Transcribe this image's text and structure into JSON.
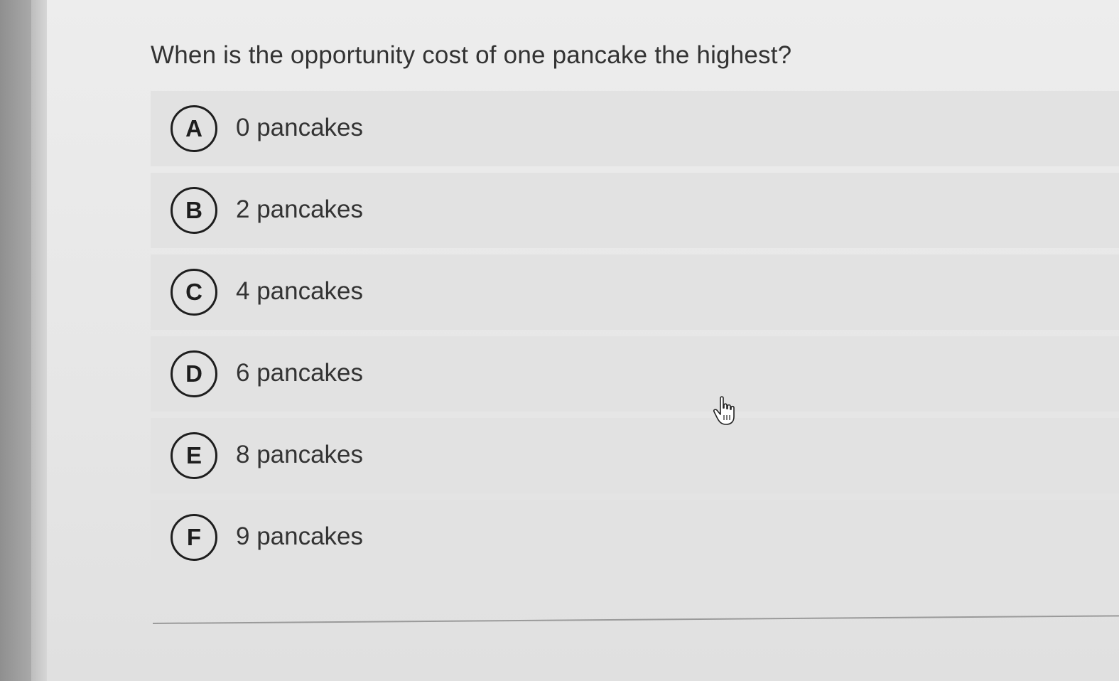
{
  "question": {
    "text": "When is the opportunity cost of one pancake the highest?"
  },
  "options": [
    {
      "letter": "A",
      "label": "0 pancakes"
    },
    {
      "letter": "B",
      "label": "2 pancakes"
    },
    {
      "letter": "C",
      "label": "4 pancakes"
    },
    {
      "letter": "D",
      "label": "6 pancakes"
    },
    {
      "letter": "E",
      "label": "8 pancakes"
    },
    {
      "letter": "F",
      "label": "9 pancakes"
    }
  ],
  "cursor": {
    "icon": "hand-pointer-icon"
  }
}
